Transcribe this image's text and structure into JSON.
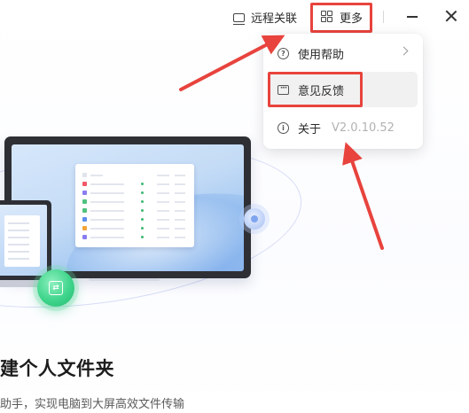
{
  "topbar": {
    "remote_label": "远程关联",
    "more_label": "更多",
    "remote_icon": "monitor-icon",
    "more_icon": "grid-icon"
  },
  "menu": {
    "help_label": "使用帮助",
    "feedback_label": "意见反馈",
    "about_label": "关于",
    "version": "V2.0.10.52"
  },
  "main": {
    "headline": "建个人文件夹",
    "subline": "助手，实现电脑到大屏高效文件传输"
  },
  "colors": {
    "annotation": "#e8433d",
    "accent_green": "#3fd58b"
  }
}
